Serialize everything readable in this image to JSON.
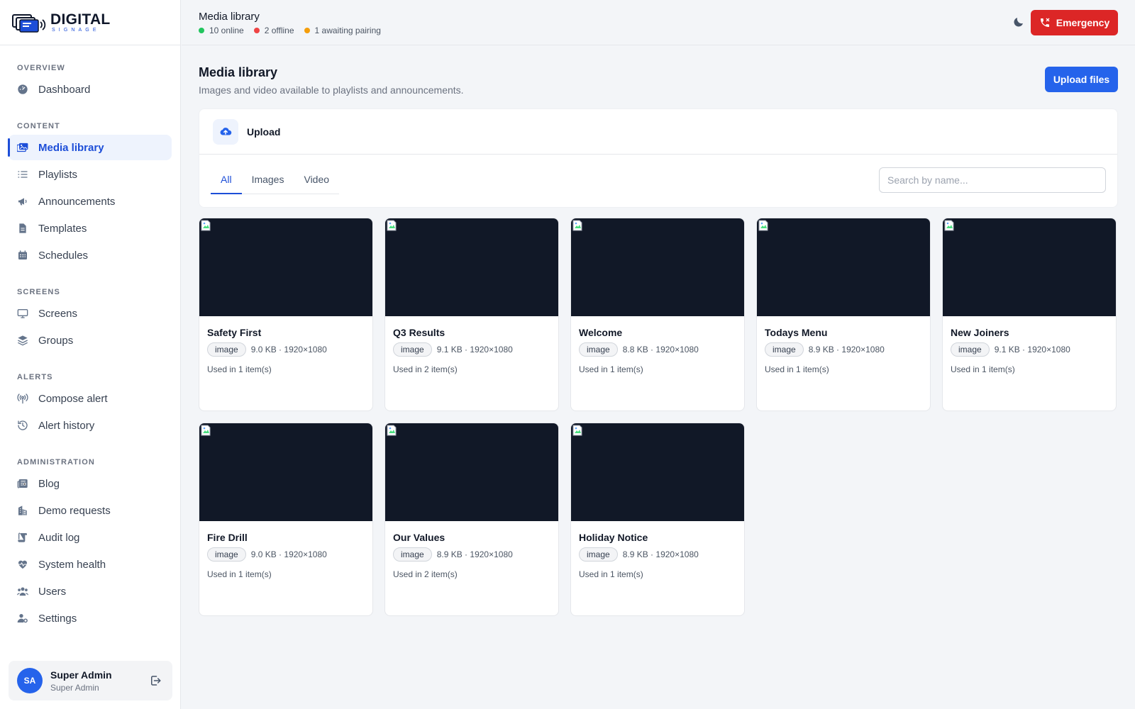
{
  "brand": {
    "line1": "DIGITAL",
    "line2": "SIGNAGE"
  },
  "sidebar": {
    "sections": [
      {
        "title": "OVERVIEW",
        "items": [
          {
            "label": "Dashboard",
            "icon": "dashboard-icon"
          }
        ]
      },
      {
        "title": "CONTENT",
        "items": [
          {
            "label": "Media library",
            "icon": "media-icon",
            "active": true
          },
          {
            "label": "Playlists",
            "icon": "list-icon"
          },
          {
            "label": "Announcements",
            "icon": "megaphone-icon"
          },
          {
            "label": "Templates",
            "icon": "file-icon"
          },
          {
            "label": "Schedules",
            "icon": "calendar-icon"
          }
        ]
      },
      {
        "title": "SCREENS",
        "items": [
          {
            "label": "Screens",
            "icon": "monitor-icon"
          },
          {
            "label": "Groups",
            "icon": "layers-icon"
          }
        ]
      },
      {
        "title": "ALERTS",
        "items": [
          {
            "label": "Compose alert",
            "icon": "broadcast-icon"
          },
          {
            "label": "Alert history",
            "icon": "history-icon"
          }
        ]
      },
      {
        "title": "ADMINISTRATION",
        "items": [
          {
            "label": "Blog",
            "icon": "newspaper-icon"
          },
          {
            "label": "Demo requests",
            "icon": "building-icon"
          },
          {
            "label": "Audit log",
            "icon": "scroll-icon"
          },
          {
            "label": "System health",
            "icon": "heart-pulse-icon"
          },
          {
            "label": "Users",
            "icon": "users-icon"
          },
          {
            "label": "Settings",
            "icon": "user-gear-icon"
          }
        ]
      }
    ]
  },
  "user": {
    "initials": "SA",
    "name": "Super Admin",
    "role": "Super Admin"
  },
  "topbar": {
    "title": "Media library",
    "status": [
      {
        "text": "10 online",
        "color": "#22c55e"
      },
      {
        "text": "2 offline",
        "color": "#ef4444"
      },
      {
        "text": "1 awaiting pairing",
        "color": "#f59e0b"
      }
    ],
    "emergency_label": "Emergency"
  },
  "page": {
    "title": "Media library",
    "subtitle": "Images and video available to playlists and announcements.",
    "upload_files_label": "Upload files",
    "upload_label": "Upload",
    "tabs": [
      "All",
      "Images",
      "Video"
    ],
    "active_tab": 0,
    "search_placeholder": "Search by name..."
  },
  "media": [
    {
      "name": "Safety First",
      "type": "image",
      "size": "9.0 KB",
      "dims": "1920×1080",
      "usage": "Used in 1 item(s)"
    },
    {
      "name": "Q3 Results",
      "type": "image",
      "size": "9.1 KB",
      "dims": "1920×1080",
      "usage": "Used in 2 item(s)"
    },
    {
      "name": "Welcome",
      "type": "image",
      "size": "8.8 KB",
      "dims": "1920×1080",
      "usage": "Used in 1 item(s)"
    },
    {
      "name": "Todays Menu",
      "type": "image",
      "size": "8.9 KB",
      "dims": "1920×1080",
      "usage": "Used in 1 item(s)"
    },
    {
      "name": "New Joiners",
      "type": "image",
      "size": "9.1 KB",
      "dims": "1920×1080",
      "usage": "Used in 1 item(s)"
    },
    {
      "name": "Fire Drill",
      "type": "image",
      "size": "9.0 KB",
      "dims": "1920×1080",
      "usage": "Used in 1 item(s)"
    },
    {
      "name": "Our Values",
      "type": "image",
      "size": "8.9 KB",
      "dims": "1920×1080",
      "usage": "Used in 2 item(s)"
    },
    {
      "name": "Holiday Notice",
      "type": "image",
      "size": "8.9 KB",
      "dims": "1920×1080",
      "usage": "Used in 1 item(s)"
    }
  ],
  "colors": {
    "accent": "#1d4ed8",
    "primary_button": "#2563eb",
    "danger": "#dc2626",
    "thumb_bg": "#111827"
  }
}
